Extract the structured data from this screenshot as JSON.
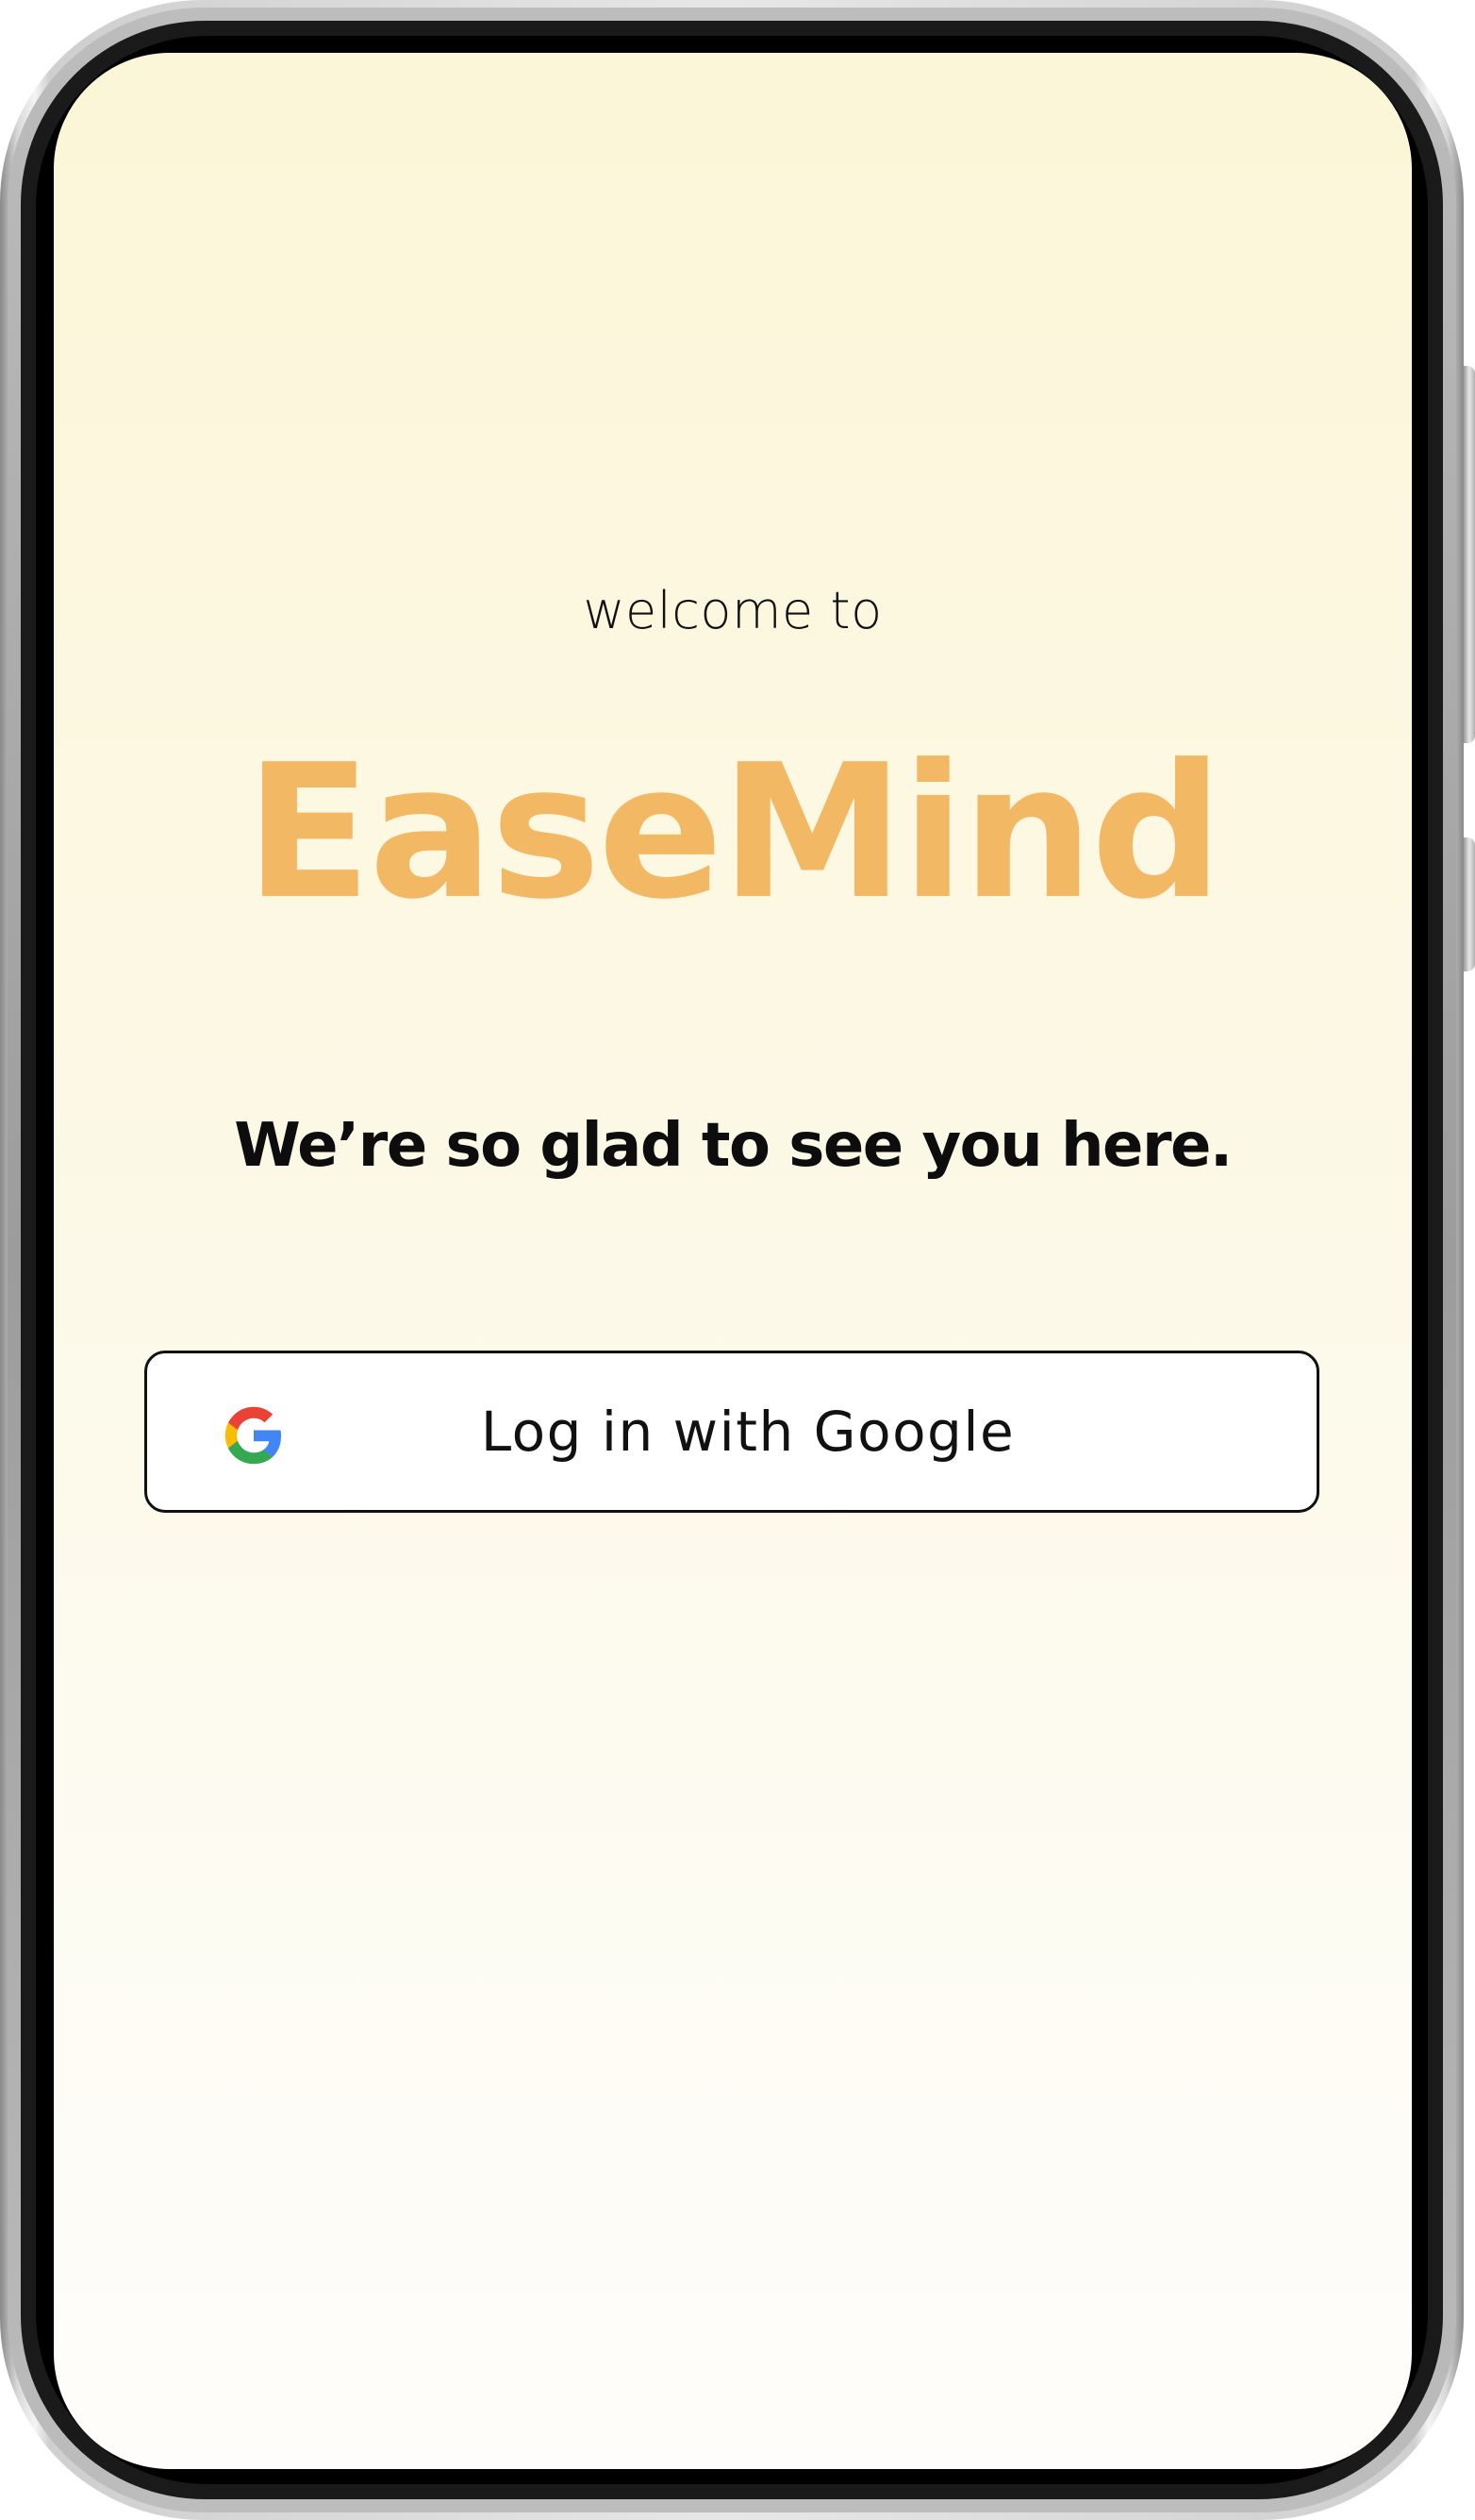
{
  "login": {
    "welcome_text": "welcome to",
    "app_name": "EaseMind",
    "tagline": "We’re so glad to see you here.",
    "google_button_label": "Log in with Google",
    "google_button_icon": "google-g-icon"
  },
  "colors": {
    "brand": "#f3b863",
    "background_top": "#fcf6d8",
    "background_bottom": "#fefdfb",
    "button_border": "#111111",
    "text": "#111111",
    "google_red": "#ea4335",
    "google_yellow": "#fbbc05",
    "google_green": "#34a853",
    "google_blue": "#4285f4"
  }
}
